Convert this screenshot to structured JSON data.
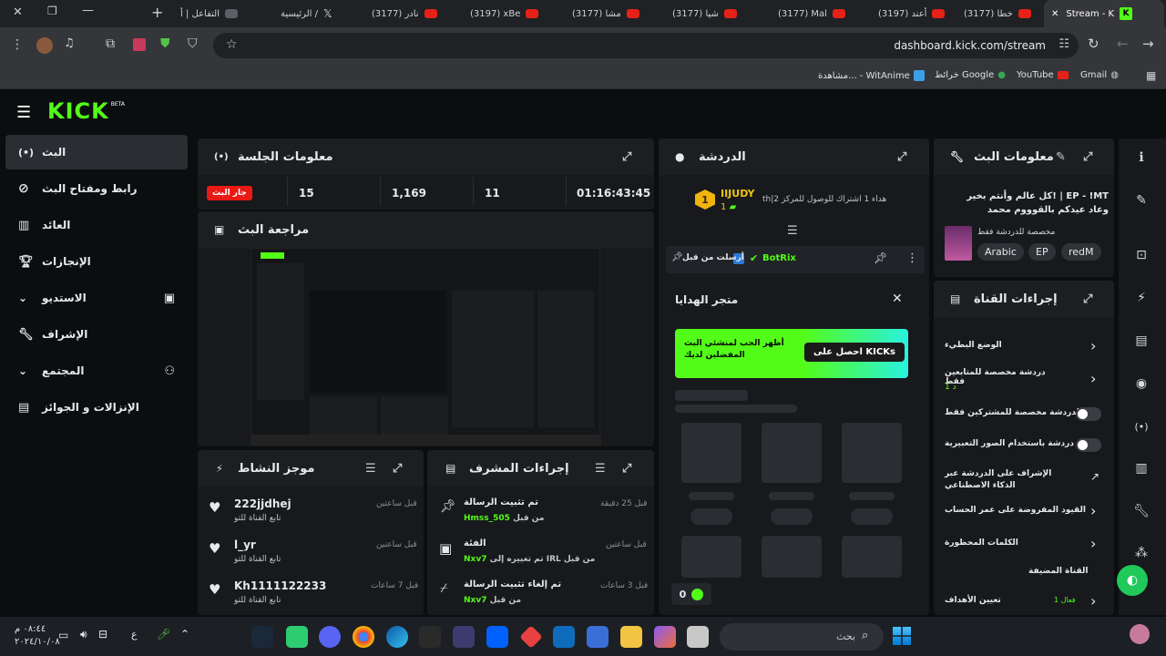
{
  "browser": {
    "tabs": [
      {
        "label": "Stream - K",
        "active": true
      },
      {
        "label": "(3177) خطا"
      },
      {
        "label": "(3197) أعند"
      },
      {
        "label": "(3177) Mal"
      },
      {
        "label": "(3177) شيا"
      },
      {
        "label": "(3177) مشا"
      },
      {
        "label": "(3197) xBe"
      },
      {
        "label": "(3177) نادر"
      },
      {
        "label": "الرئيسية /"
      },
      {
        "label": "التفاعل | أ"
      }
    ],
    "url": "dashboard.kick.com/stream",
    "bookmarks": [
      "Gmail",
      "YouTube",
      "خرائط Google",
      "مشاهدة... - WitAnime"
    ],
    "all_bookmarks_icon": "grid-icon"
  },
  "kick": {
    "logo": "KICK",
    "beta": "BETA",
    "nav": [
      {
        "label": "البث",
        "icon": "broadcast-icon",
        "active": true
      },
      {
        "label": "رابط ومفتاح البث",
        "icon": "link-icon"
      },
      {
        "label": "العائد",
        "icon": "chart-icon"
      },
      {
        "label": "الإنجازات",
        "icon": "trophy-icon"
      },
      {
        "label": "الاستديو",
        "icon": "studio-icon",
        "chevron": true
      },
      {
        "label": "الإشراف",
        "icon": "wrench-icon"
      },
      {
        "label": "المجتمع",
        "icon": "community-icon",
        "chevron": true
      },
      {
        "label": "الإنزالات و الجوائز",
        "icon": "gift-icon"
      }
    ]
  },
  "session": {
    "title": "معلومات الجلسة",
    "live_badge": "جار البث",
    "stats": [
      "15",
      "1,169",
      "11",
      "01:16:43:45"
    ]
  },
  "preview": {
    "title": "مراجعة البث"
  },
  "activity": {
    "title": "موجز النشاط",
    "items": [
      {
        "name": "222jjdhej",
        "sub": "تابع القناة للتو",
        "time": "قبل ساعتين"
      },
      {
        "name": "l_yr",
        "sub": "تابع القناة للتو",
        "time": "قبل ساعتين"
      },
      {
        "name": "Kh1111122233",
        "sub": "تابع القناة للتو",
        "time": "قبل 7 ساعات"
      }
    ]
  },
  "mod_actions": {
    "title": "إجراءات المشرف",
    "items": [
      {
        "title": "تم تثبيت الرسالة",
        "by_prefix": "من قبل",
        "user": "Hmss_505",
        "time": "قبل 25 دقيقة"
      },
      {
        "title": "الفئة",
        "by_prefix": "تم تغييره إلى IRL من قبل",
        "user": "Nxv7",
        "time": "قبل ساعتين"
      },
      {
        "title": "تم إلغاء تثبيت الرسالة",
        "by_prefix": "من قبل",
        "user": "Nxv7",
        "time": "قبل 3 ساعات"
      }
    ]
  },
  "chat": {
    "title": "الدردشة",
    "event_user": "IIJUDY",
    "event_text": "th|هداء 1 اشتراك للوصول للمركز 2",
    "event_rank": "1",
    "event_count": "1",
    "pinned_by": "BotRix",
    "pinned_label": "أرسلت من قبل",
    "gift_title": "متجر الهدايا",
    "gift_banner_text": "أظهر الحب لمنشئي البث المفضلين لديك",
    "gift_button": "احصل على KICKs",
    "kicks_balance": "0"
  },
  "stream_info": {
    "title": "معلومات البث",
    "stream_title": "EP - !MT | !كل عالم وأنتم بخير وعاد عيدكم بالقوووم محمد",
    "category": "مخصصة للدردشة فقط",
    "tags": [
      "Arabic",
      "EP",
      "redM"
    ]
  },
  "channel_actions": {
    "title": "إجراءات القناة",
    "items": [
      {
        "label": "الوضع البطيء",
        "type": "chevron"
      },
      {
        "label": "دردشة مخصصة للمتابعين فقط",
        "sub": "1 د",
        "type": "chevron"
      },
      {
        "label": "الدردشة مخصصة للمشتركين فقط",
        "type": "toggle"
      },
      {
        "label": "دردشة باستخدام الصور التعبيرية",
        "type": "toggle"
      },
      {
        "label": "الإشراف على الدردشة عبر الذكاء الاصطناعي",
        "type": "external"
      },
      {
        "label": "القيود المفروضة على عمر الحساب",
        "type": "chevron"
      },
      {
        "label": "الكلمات المحظورة",
        "type": "chevron"
      },
      {
        "label": "القناة المضيفة",
        "type": "none"
      },
      {
        "label": "تعيين الأهداف",
        "sub": "فعال 1",
        "type": "chevron"
      }
    ]
  },
  "taskbar": {
    "search_placeholder": "بحث",
    "time": "٠٨:٤٤ م",
    "date": "٢٠٢٤/١٠/٠٨",
    "lang": "ع"
  },
  "colors": {
    "accent": "#53fc18",
    "bg": "#0b0e0f",
    "panel": "#17191c",
    "live": "#e91916"
  }
}
